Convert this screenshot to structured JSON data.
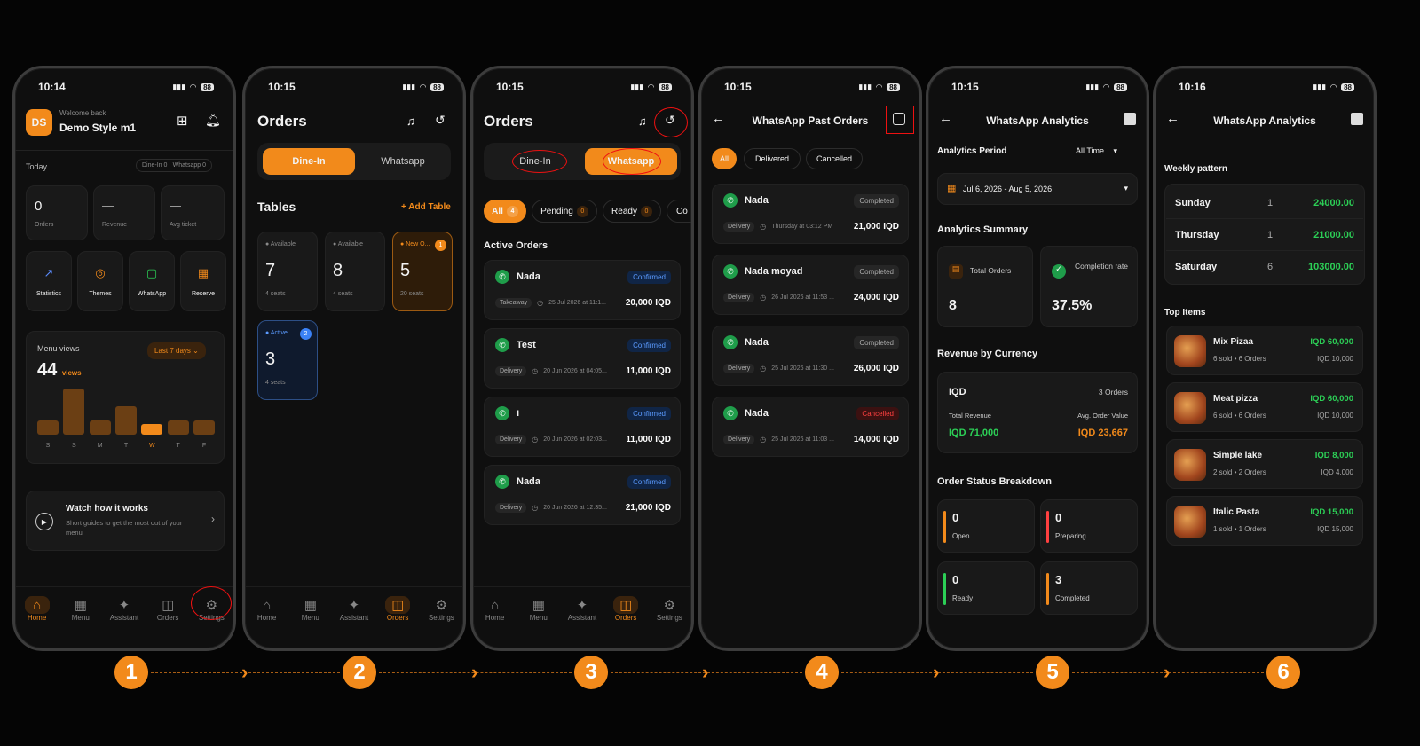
{
  "colors": {
    "accent": "#f28a1b",
    "success": "#2ccf56",
    "danger": "#ff4040",
    "info": "#3b82f6",
    "bg": "#050505"
  },
  "phone1": {
    "time": "10:14",
    "battery": "88",
    "avatar": "DS",
    "welcome": "Welcome back",
    "name": "Demo Style m1",
    "today": "Today",
    "today_badge": "Dine-In 0 · Whatsapp 0",
    "stats": [
      {
        "value": "0",
        "label": "Orders"
      },
      {
        "value": "—",
        "label": "Revenue"
      },
      {
        "value": "—",
        "label": "Avg ticket"
      }
    ],
    "quick": [
      {
        "label": "Statistics",
        "icon": "chart-icon"
      },
      {
        "label": "Themes",
        "icon": "palette-icon"
      },
      {
        "label": "WhatsApp",
        "icon": "chat-icon"
      },
      {
        "label": "Reserve",
        "icon": "calendar-icon"
      }
    ],
    "menu_views_title": "Menu views",
    "menu_views_count": "44",
    "menu_views_unit": "views",
    "period": "Last 7 days",
    "days": [
      "S",
      "S",
      "M",
      "T",
      "W",
      "T",
      "F"
    ],
    "bar_values": [
      3,
      12,
      3,
      7,
      2,
      3,
      3
    ],
    "active_day_index": 4,
    "watch_title": "Watch how it works",
    "watch_desc": "Short guides to get the most out of your menu"
  },
  "nav1": [
    {
      "label": "Home",
      "icon": "home-icon"
    },
    {
      "label": "Menu",
      "icon": "grid-icon"
    },
    {
      "label": "Assistant",
      "icon": "sparkle-icon"
    },
    {
      "label": "Orders",
      "icon": "bag-icon"
    },
    {
      "label": "Settings",
      "icon": "gear-icon"
    }
  ],
  "phone2": {
    "time": "10:15",
    "battery": "88",
    "title": "Orders",
    "tab_dinein": "Dine-In",
    "tab_whatsapp": "Whatsapp",
    "tables_title": "Tables",
    "add_table": "+ Add Table",
    "tables": [
      {
        "status": "Available",
        "number": "7",
        "seats": "4 seats"
      },
      {
        "status": "Available",
        "number": "8",
        "seats": "4 seats"
      },
      {
        "status": "New O...",
        "number": "5",
        "seats": "20 seats",
        "badge": "1"
      },
      {
        "status": "Active",
        "number": "3",
        "seats": "4 seats",
        "badge": "2"
      }
    ]
  },
  "phone3": {
    "time": "10:15",
    "battery": "88",
    "title": "Orders",
    "tab_dinein": "Dine-In",
    "tab_whatsapp": "Whatsapp",
    "filters": [
      {
        "label": "All",
        "count": "4"
      },
      {
        "label": "Pending",
        "count": "0"
      },
      {
        "label": "Ready",
        "count": "0"
      },
      {
        "label": "Co",
        "count": ""
      }
    ],
    "section": "Active Orders",
    "orders": [
      {
        "name": "Nada",
        "status": "Confirmed",
        "type": "Takeaway",
        "date": "25 Jul 2026 at 11:1...",
        "amount": "20,000 IQD"
      },
      {
        "name": "Test",
        "status": "Confirmed",
        "type": "Delivery",
        "date": "20 Jun 2026 at 04:05...",
        "amount": "11,000 IQD"
      },
      {
        "name": "ו",
        "status": "Confirmed",
        "type": "Delivery",
        "date": "20 Jun 2026 at 02:03...",
        "amount": "11,000 IQD"
      },
      {
        "name": "Nada",
        "status": "Confirmed",
        "type": "Delivery",
        "date": "20 Jun 2026 at 12:35...",
        "amount": "21,000 IQD"
      }
    ]
  },
  "phone4": {
    "time": "10:15",
    "battery": "88",
    "title": "WhatsApp Past Orders",
    "filters": [
      "All",
      "Delivered",
      "Cancelled"
    ],
    "orders": [
      {
        "name": "Nada",
        "status": "Completed",
        "type": "Delivery",
        "date": "Thursday at 03:12 PM",
        "amount": "21,000 IQD"
      },
      {
        "name": "Nada moyad",
        "status": "Completed",
        "type": "Delivery",
        "date": "26 Jul 2026 at 11:53 ...",
        "amount": "24,000 IQD"
      },
      {
        "name": "Nada",
        "status": "Completed",
        "type": "Delivery",
        "date": "25 Jul 2026 at 11:30 ...",
        "amount": "26,000 IQD"
      },
      {
        "name": "Nada",
        "status": "Cancelled",
        "type": "Delivery",
        "date": "25 Jul 2026 at 11:03 ...",
        "amount": "14,000 IQD"
      }
    ]
  },
  "phone5": {
    "time": "10:15",
    "battery": "88",
    "title": "WhatsApp Analytics",
    "period_label": "Analytics Period",
    "period_value": "All Time",
    "date_range": "Jul 6, 2026 - Aug 5, 2026",
    "summary_title": "Analytics Summary",
    "total_orders_label": "Total Orders",
    "total_orders": "8",
    "completion_label": "Completion rate",
    "completion": "37.5%",
    "revenue_title": "Revenue by Currency",
    "currency": "IQD",
    "currency_orders": "3 Orders",
    "total_rev_label": "Total Revenue",
    "total_rev": "IQD 71,000",
    "avg_label": "Avg. Order Value",
    "avg": "IQD 23,667",
    "status_title": "Order Status Breakdown",
    "statuses": [
      {
        "value": "0",
        "label": "Open",
        "color": "#f28a1b"
      },
      {
        "value": "0",
        "label": "Preparing",
        "color": "#ff4040"
      },
      {
        "value": "0",
        "label": "Ready",
        "color": "#2ccf56"
      },
      {
        "value": "3",
        "label": "Completed",
        "color": "#f28a1b"
      }
    ]
  },
  "phone6": {
    "time": "10:16",
    "battery": "88",
    "title": "WhatsApp Analytics",
    "weekly_title": "Weekly pattern",
    "weekly": [
      {
        "day": "Sunday",
        "count": "1",
        "amount": "24000.00"
      },
      {
        "day": "Thursday",
        "count": "1",
        "amount": "21000.00"
      },
      {
        "day": "Saturday",
        "count": "6",
        "amount": "103000.00"
      }
    ],
    "top_title": "Top Items",
    "items": [
      {
        "name": "Mix Pizaa",
        "meta": "6 sold • 6 Orders",
        "total": "IQD 60,000",
        "unit": "IQD 10,000"
      },
      {
        "name": "Meat pizza",
        "meta": "6 sold • 6 Orders",
        "total": "IQD 60,000",
        "unit": "IQD 10,000"
      },
      {
        "name": "Simple lake",
        "meta": "2 sold • 2 Orders",
        "total": "IQD 8,000",
        "unit": "IQD 4,000"
      },
      {
        "name": "Italic Pasta",
        "meta": "1 sold • 1 Orders",
        "total": "IQD 15,000",
        "unit": "IQD 15,000"
      }
    ]
  },
  "steps": [
    "1",
    "2",
    "3",
    "4",
    "5",
    "6"
  ]
}
